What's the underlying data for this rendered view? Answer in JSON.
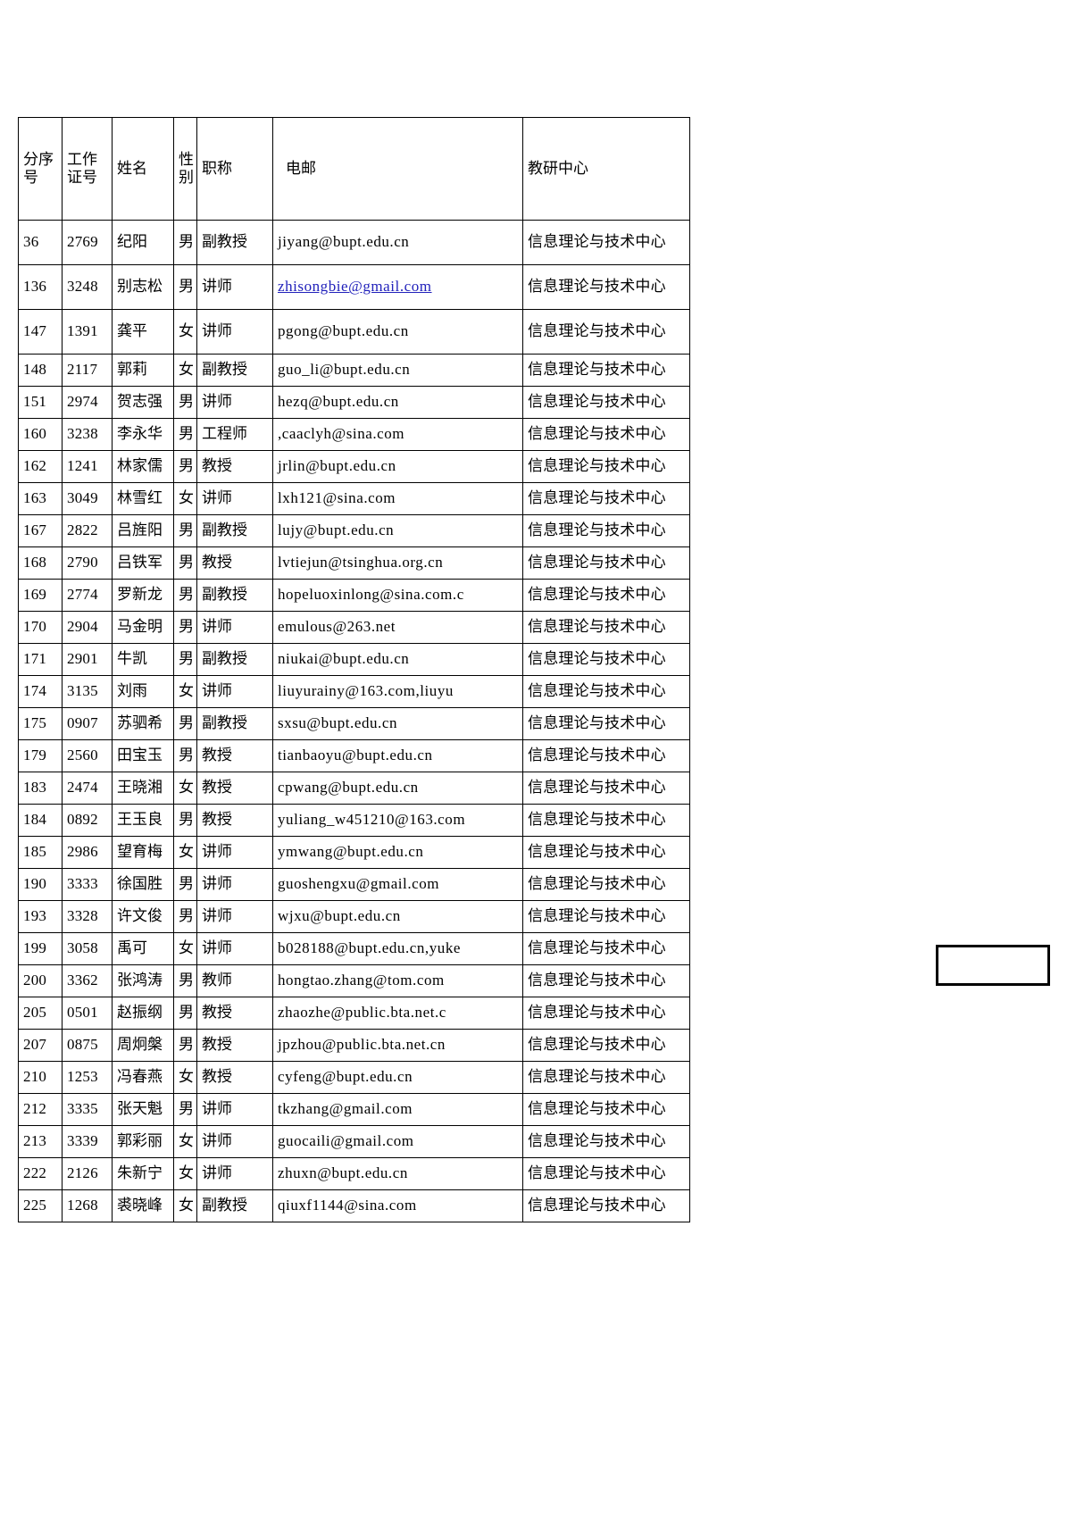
{
  "document": {
    "table_title": "",
    "columns": [
      {
        "key": "seq",
        "label": "分序号"
      },
      {
        "key": "id",
        "label": "工作证号"
      },
      {
        "key": "name",
        "label": "姓名"
      },
      {
        "key": "gender",
        "label": "性别"
      },
      {
        "key": "title",
        "label": "职称"
      },
      {
        "key": "email",
        "label": "电邮"
      },
      {
        "key": "center",
        "label": "教研中心"
      }
    ],
    "center_name": "信息理论与技术中心",
    "link_color": "#2222bb",
    "rows": [
      {
        "seq": "36",
        "id": "2769",
        "name": "纪阳",
        "gender": "男",
        "title": "副教授",
        "email": "jiyang@bupt.edu.cn",
        "email_is_link": false,
        "center": "信息理论与技术中心"
      },
      {
        "seq": "136",
        "id": "3248",
        "name": "别志松",
        "gender": "男",
        "title": "讲师",
        "email": "zhisongbie@gmail.com",
        "email_is_link": true,
        "center": "信息理论与技术中心"
      },
      {
        "seq": "147",
        "id": "1391",
        "name": "龚平",
        "gender": "女",
        "title": "讲师",
        "email": "pgong@bupt.edu.cn",
        "email_is_link": false,
        "center": "信息理论与技术中心"
      },
      {
        "seq": "148",
        "id": "2117",
        "name": "郭莉",
        "gender": "女",
        "title": "副教授",
        "email": "guo_li@bupt.edu.cn",
        "email_is_link": false,
        "center": "信息理论与技术中心"
      },
      {
        "seq": "151",
        "id": "2974",
        "name": "贺志强",
        "gender": "男",
        "title": "讲师",
        "email": "hezq@bupt.edu.cn",
        "email_is_link": false,
        "center": "信息理论与技术中心"
      },
      {
        "seq": "160",
        "id": "3238",
        "name": "李永华",
        "gender": "男",
        "title": "工程师",
        "email": ",caaclyh@sina.com",
        "email_is_link": false,
        "center": "信息理论与技术中心"
      },
      {
        "seq": "162",
        "id": "1241",
        "name": "林家儒",
        "gender": "男",
        "title": "教授",
        "email": "jrlin@bupt.edu.cn",
        "email_is_link": false,
        "center": "信息理论与技术中心"
      },
      {
        "seq": "163",
        "id": "3049",
        "name": "林雪红",
        "gender": "女",
        "title": "讲师",
        "email": "lxh121@sina.com",
        "email_is_link": false,
        "center": "信息理论与技术中心"
      },
      {
        "seq": "167",
        "id": "2822",
        "name": "吕旌阳",
        "gender": "男",
        "title": "副教授",
        "email": "lujy@bupt.edu.cn",
        "email_is_link": false,
        "center": "信息理论与技术中心"
      },
      {
        "seq": "168",
        "id": "2790",
        "name": "吕铁军",
        "gender": "男",
        "title": "教授",
        "email": "lvtiejun@tsinghua.org.cn",
        "email_is_link": false,
        "center": "信息理论与技术中心"
      },
      {
        "seq": "169",
        "id": "2774",
        "name": "罗新龙",
        "gender": "男",
        "title": "副教授",
        "email": "hopeluoxinlong@sina.com.c",
        "email_is_link": false,
        "center": "信息理论与技术中心"
      },
      {
        "seq": "170",
        "id": "2904",
        "name": "马金明",
        "gender": "男",
        "title": "讲师",
        "email": "emulous@263.net",
        "email_is_link": false,
        "center": "信息理论与技术中心"
      },
      {
        "seq": "171",
        "id": "2901",
        "name": "牛凯",
        "gender": "男",
        "title": "副教授",
        "email": "niukai@bupt.edu.cn",
        "email_is_link": false,
        "center": "信息理论与技术中心"
      },
      {
        "seq": "174",
        "id": "3135",
        "name": "刘雨",
        "gender": "女",
        "title": "讲师",
        "email": "liuyurainy@163.com,liuyu",
        "email_is_link": false,
        "center": "信息理论与技术中心"
      },
      {
        "seq": "175",
        "id": "0907",
        "name": "苏驷希",
        "gender": "男",
        "title": "副教授",
        "email": "sxsu@bupt.edu.cn",
        "email_is_link": false,
        "center": "信息理论与技术中心"
      },
      {
        "seq": "179",
        "id": "2560",
        "name": "田宝玉",
        "gender": "男",
        "title": "教授",
        "email": "tianbaoyu@bupt.edu.cn",
        "email_is_link": false,
        "center": "信息理论与技术中心"
      },
      {
        "seq": "183",
        "id": "2474",
        "name": "王晓湘",
        "gender": "女",
        "title": "教授",
        "email": "cpwang@bupt.edu.cn",
        "email_is_link": false,
        "center": "信息理论与技术中心"
      },
      {
        "seq": "184",
        "id": "0892",
        "name": "王玉良",
        "gender": "男",
        "title": "教授",
        "email": "yuliang_w451210@163.com",
        "email_is_link": false,
        "center": "信息理论与技术中心"
      },
      {
        "seq": "185",
        "id": "2986",
        "name": "望育梅",
        "gender": "女",
        "title": "讲师",
        "email": "ymwang@bupt.edu.cn",
        "email_is_link": false,
        "center": "信息理论与技术中心"
      },
      {
        "seq": "190",
        "id": "3333",
        "name": "徐国胜",
        "gender": "男",
        "title": "讲师",
        "email": "guoshengxu@gmail.com",
        "email_is_link": false,
        "center": "信息理论与技术中心"
      },
      {
        "seq": "193",
        "id": "3328",
        "name": "许文俊",
        "gender": "男",
        "title": "讲师",
        "email": "wjxu@bupt.edu.cn",
        "email_is_link": false,
        "center": "信息理论与技术中心"
      },
      {
        "seq": "199",
        "id": "3058",
        "name": "禹可",
        "gender": "女",
        "title": "讲师",
        "email": "b028188@bupt.edu.cn,yuke",
        "email_is_link": false,
        "center": "信息理论与技术中心"
      },
      {
        "seq": "200",
        "id": "3362",
        "name": "张鸿涛",
        "gender": "男",
        "title": "教师",
        "email": "hongtao.zhang@tom.com",
        "email_is_link": false,
        "center": "信息理论与技术中心"
      },
      {
        "seq": "205",
        "id": "0501",
        "name": "赵振纲",
        "gender": "男",
        "title": "教授",
        "email": "zhaozhe@public.bta.net.c",
        "email_is_link": false,
        "center": "信息理论与技术中心"
      },
      {
        "seq": "207",
        "id": "0875",
        "name": "周炯槃",
        "gender": "男",
        "title": "教授",
        "email": "jpzhou@public.bta.net.cn",
        "email_is_link": false,
        "center": "信息理论与技术中心"
      },
      {
        "seq": "210",
        "id": "1253",
        "name": "冯春燕",
        "gender": "女",
        "title": "教授",
        "email": "cyfeng@bupt.edu.cn",
        "email_is_link": false,
        "center": "信息理论与技术中心"
      },
      {
        "seq": "212",
        "id": "3335",
        "name": "张天魁",
        "gender": "男",
        "title": "讲师",
        "email": "tkzhang@gmail.com",
        "email_is_link": false,
        "center": "信息理论与技术中心"
      },
      {
        "seq": "213",
        "id": "3339",
        "name": "郭彩丽",
        "gender": "女",
        "title": "讲师",
        "email": "guocaili@gmail.com",
        "email_is_link": false,
        "center": "信息理论与技术中心"
      },
      {
        "seq": "222",
        "id": "2126",
        "name": "朱新宁",
        "gender": "女",
        "title": "讲师",
        "email": "zhuxn@bupt.edu.cn",
        "email_is_link": false,
        "center": "信息理论与技术中心"
      },
      {
        "seq": "225",
        "id": "1268",
        "name": "裘晓峰",
        "gender": "女",
        "title": "副教授",
        "email": "qiuxf1144@sina.com",
        "email_is_link": false,
        "center": "信息理论与技术中心"
      }
    ],
    "stray_box": {
      "label": ""
    }
  }
}
